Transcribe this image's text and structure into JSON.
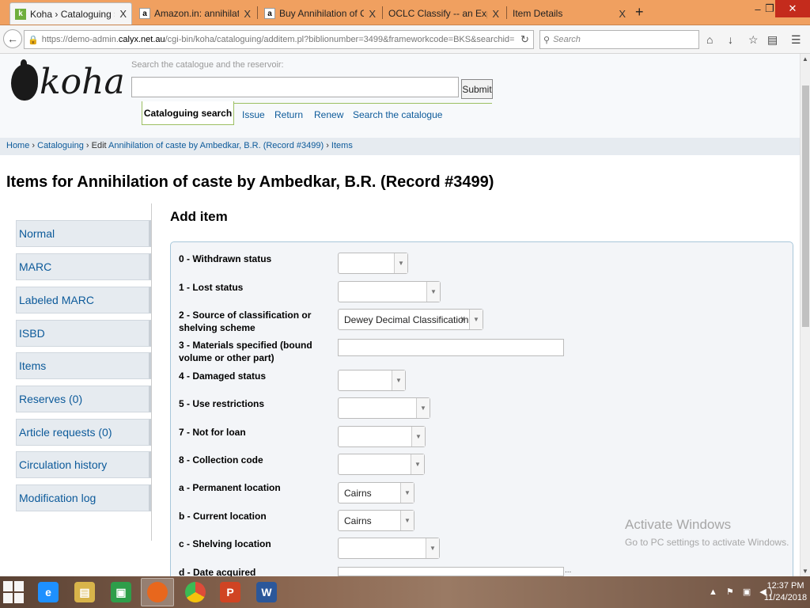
{
  "browser": {
    "tabs": [
      {
        "title": "Koha › Cataloguing › Anni...",
        "icon": "koha-favicon",
        "active": true
      },
      {
        "title": "Amazon.in: annihilation o...",
        "icon": "amazon-favicon",
        "active": false
      },
      {
        "title": "Buy Annihilation of Caste:...",
        "icon": "amazon-favicon",
        "active": false
      },
      {
        "title": "OCLC Classify -- an Experimen...",
        "icon": "none",
        "active": false
      },
      {
        "title": "Item Details",
        "icon": "none",
        "active": false
      }
    ],
    "close_glyph": "X",
    "new_tab": "+",
    "url_prefix": "https://demo-admin.",
    "url_domain": "calyx.net.au",
    "url_rest": "/cgi-bin/koha/cataloguing/additem.pl?biblionumber=3499&frameworkcode=BKS&searchid=",
    "search_placeholder": "Search",
    "window_controls": {
      "minimize": "–",
      "restore": "❐",
      "close": "✕"
    }
  },
  "header": {
    "logo_text": "koha",
    "search_label": "Search the catalogue and the reservoir:",
    "search_value": "",
    "submit_label": "Submit",
    "tabs": [
      {
        "label": "Cataloguing search",
        "active": true
      },
      {
        "label": "Issue"
      },
      {
        "label": "Return"
      },
      {
        "label": "Renew"
      },
      {
        "label": "Search the catalogue"
      }
    ]
  },
  "breadcrumb": {
    "home": "Home",
    "sep": " › ",
    "cataloguing": "Cataloguing",
    "edit_prefix": "Edit ",
    "record": "Annihilation of caste by Ambedkar, B.R. (Record #3499)",
    "items": "Items"
  },
  "page_title": "Items for Annihilation of caste by Ambedkar, B.R. (Record #3499)",
  "left_menu": [
    "Normal",
    "MARC",
    "Labeled MARC",
    "ISBD",
    "Items",
    "Reserves (0)",
    "Article requests (0)",
    "Circulation history",
    "Modification log"
  ],
  "form": {
    "heading": "Add item",
    "fields": [
      {
        "label": "0 - Withdrawn status",
        "type": "select",
        "value": ""
      },
      {
        "label": "1 - Lost status",
        "type": "select",
        "value": ""
      },
      {
        "label": "2 - Source of classification or shelving scheme",
        "type": "select",
        "value": "Dewey Decimal Classification",
        "clearable": true
      },
      {
        "label": "3 - Materials specified (bound volume or other part)",
        "type": "text",
        "value": ""
      },
      {
        "label": "4 - Damaged status",
        "type": "select",
        "value": ""
      },
      {
        "label": "5 - Use restrictions",
        "type": "select",
        "value": ""
      },
      {
        "label": "7 - Not for loan",
        "type": "select",
        "value": ""
      },
      {
        "label": "8 - Collection code",
        "type": "select",
        "value": ""
      },
      {
        "label": "a - Permanent location",
        "type": "select",
        "value": "Cairns"
      },
      {
        "label": "b - Current location",
        "type": "select",
        "value": "Cairns"
      },
      {
        "label": "c - Shelving location",
        "type": "select",
        "value": ""
      },
      {
        "label": "d - Date acquired",
        "type": "text",
        "value": ""
      }
    ],
    "clear_glyph": "x",
    "arrow_glyph": "▼",
    "date_suffix": "..."
  },
  "watermark": {
    "title": "Activate Windows",
    "subtitle": "Go to PC settings to activate Windows."
  },
  "taskbar": {
    "apps": [
      {
        "name": "ie-icon",
        "label": "e",
        "color": "#1e90ff"
      },
      {
        "name": "file-explorer-icon",
        "label": "",
        "color": "#d8b44a"
      },
      {
        "name": "store-icon",
        "label": "",
        "color": "#2e9e4a"
      },
      {
        "name": "firefox-icon",
        "label": "",
        "color": "#e8671d",
        "active": true
      },
      {
        "name": "chrome-icon",
        "label": "",
        "color": "#dd4b39"
      },
      {
        "name": "powerpoint-icon",
        "label": "P",
        "color": "#d04423"
      },
      {
        "name": "word-icon",
        "label": "W",
        "color": "#2b579a"
      }
    ],
    "tray": "▲ ⚑ ▣ ◀)",
    "time": "12:37 PM",
    "date": "11/24/2018"
  }
}
